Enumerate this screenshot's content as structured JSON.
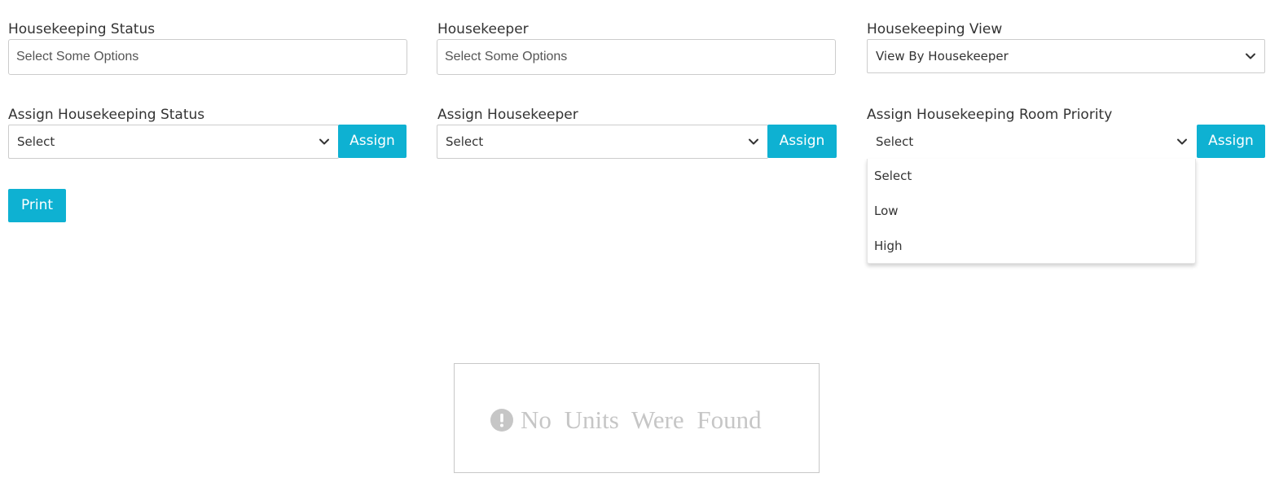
{
  "filters": {
    "housekeeping_status": {
      "label": "Housekeeping Status",
      "placeholder": "Select Some Options"
    },
    "housekeeper": {
      "label": "Housekeeper",
      "placeholder": "Select Some Options"
    },
    "housekeeping_view": {
      "label": "Housekeeping View",
      "value": "View By Housekeeper"
    }
  },
  "assign": {
    "status": {
      "label": "Assign Housekeeping Status",
      "value": "Select",
      "button": "Assign"
    },
    "housekeeper": {
      "label": "Assign Housekeeper",
      "value": "Select",
      "button": "Assign"
    },
    "room_priority": {
      "label": "Assign Housekeeping Room Priority",
      "value": "Select",
      "button": "Assign",
      "options": [
        "Select",
        "Low",
        "High"
      ]
    }
  },
  "print_button": "Print",
  "empty_state": {
    "message": "No Units Were Found",
    "icon": "exclamation-circle-icon"
  },
  "colors": {
    "accent": "#0eb1d2",
    "empty_text": "#c6c6c6"
  }
}
